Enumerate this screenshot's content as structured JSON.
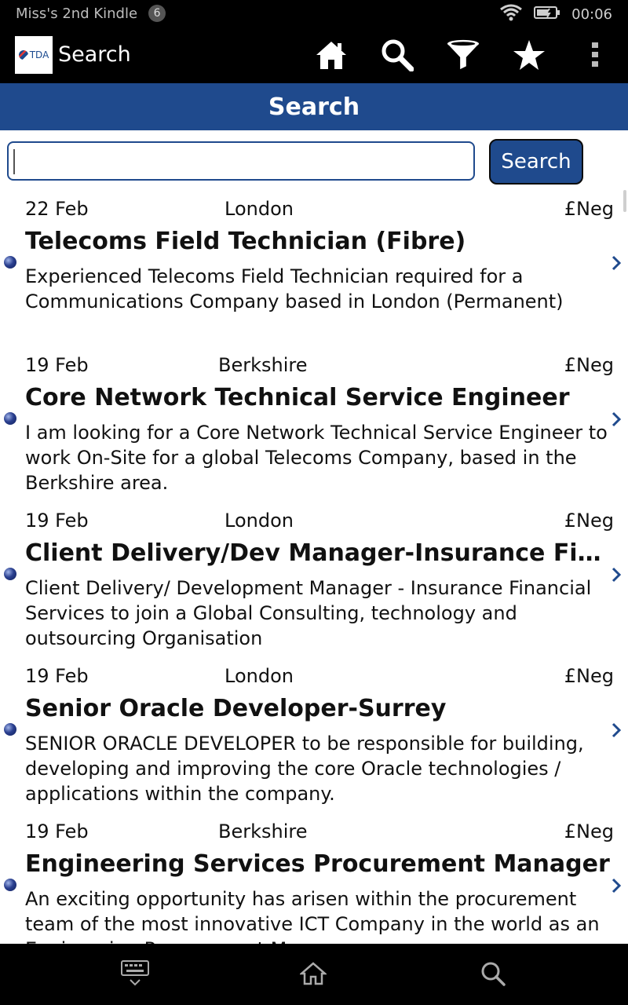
{
  "status": {
    "device_name": "Miss's 2nd Kindle",
    "notification_count": "6",
    "time": "00:06",
    "icons": [
      "wifi-icon",
      "battery-icon"
    ]
  },
  "appbar": {
    "logo_text": "TDA",
    "title": "Search",
    "actions": [
      "home-icon",
      "search-icon",
      "filter-icon",
      "star-icon",
      "overflow-menu-icon"
    ]
  },
  "header": {
    "title": "Search"
  },
  "search": {
    "value": "",
    "placeholder": "",
    "button_label": "Search"
  },
  "jobs": [
    {
      "date": "22 Feb",
      "location": "London",
      "salary": "£Neg",
      "title": "Telecoms Field Technician (Fibre)",
      "description": "Experienced Telecoms Field Technician required for a Communications Company based in London (Permanent)"
    },
    {
      "date": "19 Feb",
      "location": "Berkshire",
      "salary": "£Neg",
      "title": "Core Network Technical Service Engineer",
      "description": "I am looking for a Core Network Technical Service Engineer to work On-Site for a global Telecoms Company, based in the Berkshire area."
    },
    {
      "date": "19 Feb",
      "location": "London",
      "salary": "£Neg",
      "title": "Client Delivery/Dev Manager-Insurance Financial Services",
      "description": "Client Delivery/ Development Manager - Insurance Financial Services to join a Global Consulting, technology and outsourcing Organisation"
    },
    {
      "date": "19 Feb",
      "location": "London",
      "salary": "£Neg",
      "title": "Senior Oracle Developer-Surrey",
      "description": "SENIOR ORACLE DEVELOPER to be responsible for building, developing and improving the core Oracle technologies / applications within the company."
    },
    {
      "date": "19 Feb",
      "location": "Berkshire",
      "salary": "£Neg",
      "title": "Engineering Services Procurement Manager",
      "description": "An exciting opportunity has arisen within the procurement team of the most innovative ICT Company in the world as an Engineering Procurement Manager"
    }
  ],
  "navbar": {
    "icons": [
      "keyboard-hide-icon",
      "home-icon",
      "search-icon"
    ]
  },
  "colors": {
    "accent": "#1f4a8d",
    "bar": "#000000"
  }
}
